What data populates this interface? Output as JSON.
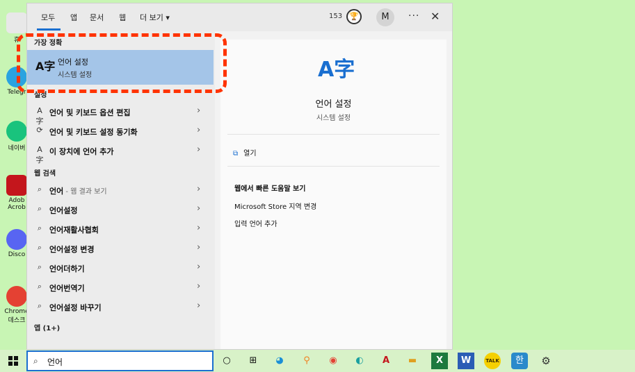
{
  "desktop": {
    "icons": [
      {
        "label": "휴",
        "color": "#e8e8e8"
      },
      {
        "label": "Telegr",
        "color": "#2aa3e0"
      },
      {
        "label": "네이버",
        "color": "#19c37d"
      },
      {
        "label": "Adob Acrob",
        "color": "#c4161c"
      },
      {
        "label": "Disco",
        "color": "#5865f2"
      },
      {
        "label": "Chrome 데스크",
        "color": "#e44133"
      }
    ]
  },
  "tabs": {
    "all": "모두",
    "apps": "앱",
    "documents": "문서",
    "web": "웹",
    "more": "더 보기 ▾"
  },
  "header": {
    "count": "153",
    "trophy_glyph": "🏆",
    "avatar_initial": "M",
    "more_glyph": "···",
    "close_glyph": "✕"
  },
  "results": {
    "best_match_header": "가장 정확",
    "best_match": {
      "icon": "A字",
      "title": "언어 설정",
      "subtitle": "시스템 설정"
    },
    "settings_header": "설정",
    "settings": [
      {
        "icon": "A字",
        "label": "언어 및 키보드 옵션 편집"
      },
      {
        "icon": "⟳",
        "label": "언어 및 키보드 설정 동기화"
      },
      {
        "icon": "A字",
        "label": "이 장치에 언어 추가"
      }
    ],
    "web_header": "웹 검색",
    "web": [
      {
        "bold": "언어",
        "sub": " - 웹 결과 보기"
      },
      {
        "bold": "언어설정",
        "sub": ""
      },
      {
        "bold": "언어재활사협회",
        "sub": ""
      },
      {
        "bold": "언어설정 변경",
        "sub": ""
      },
      {
        "bold": "언어더하기",
        "sub": ""
      },
      {
        "bold": "언어번역기",
        "sub": ""
      },
      {
        "bold": "언어설정 바꾸기",
        "sub": ""
      }
    ],
    "apps_header": "앱 (1+)",
    "chevron": "›"
  },
  "preview": {
    "icon": "A字",
    "title": "언어 설정",
    "subtitle": "시스템 설정",
    "open_icon": "⧉",
    "open_label": "열기",
    "help_title": "웹에서 빠른 도움말 보기",
    "help_links": [
      "Microsoft Store 지역 변경",
      "입력 언어 추가"
    ]
  },
  "taskbar": {
    "search_icon": "⌕",
    "search_value": "언어",
    "apps": [
      {
        "glyph": "○",
        "color": "#111"
      },
      {
        "glyph": "⊞",
        "color": "#111"
      },
      {
        "glyph": "◕",
        "color": "#1a8fd6"
      },
      {
        "glyph": "⚲",
        "color": "#f08020"
      },
      {
        "glyph": "◉",
        "color": "#e44133"
      },
      {
        "glyph": "◐",
        "color": "#1aa0a0"
      },
      {
        "glyph": "A",
        "color": "#c4161c"
      },
      {
        "glyph": "▬",
        "color": "#e0a020"
      },
      {
        "glyph": "X",
        "color": "#1d7a3e"
      },
      {
        "glyph": "W",
        "color": "#2b5cb5"
      },
      {
        "glyph": "TALK",
        "color": "#f5d000"
      },
      {
        "glyph": "한",
        "color": "#2a8acb"
      },
      {
        "glyph": "⚙",
        "color": "#333"
      }
    ]
  }
}
